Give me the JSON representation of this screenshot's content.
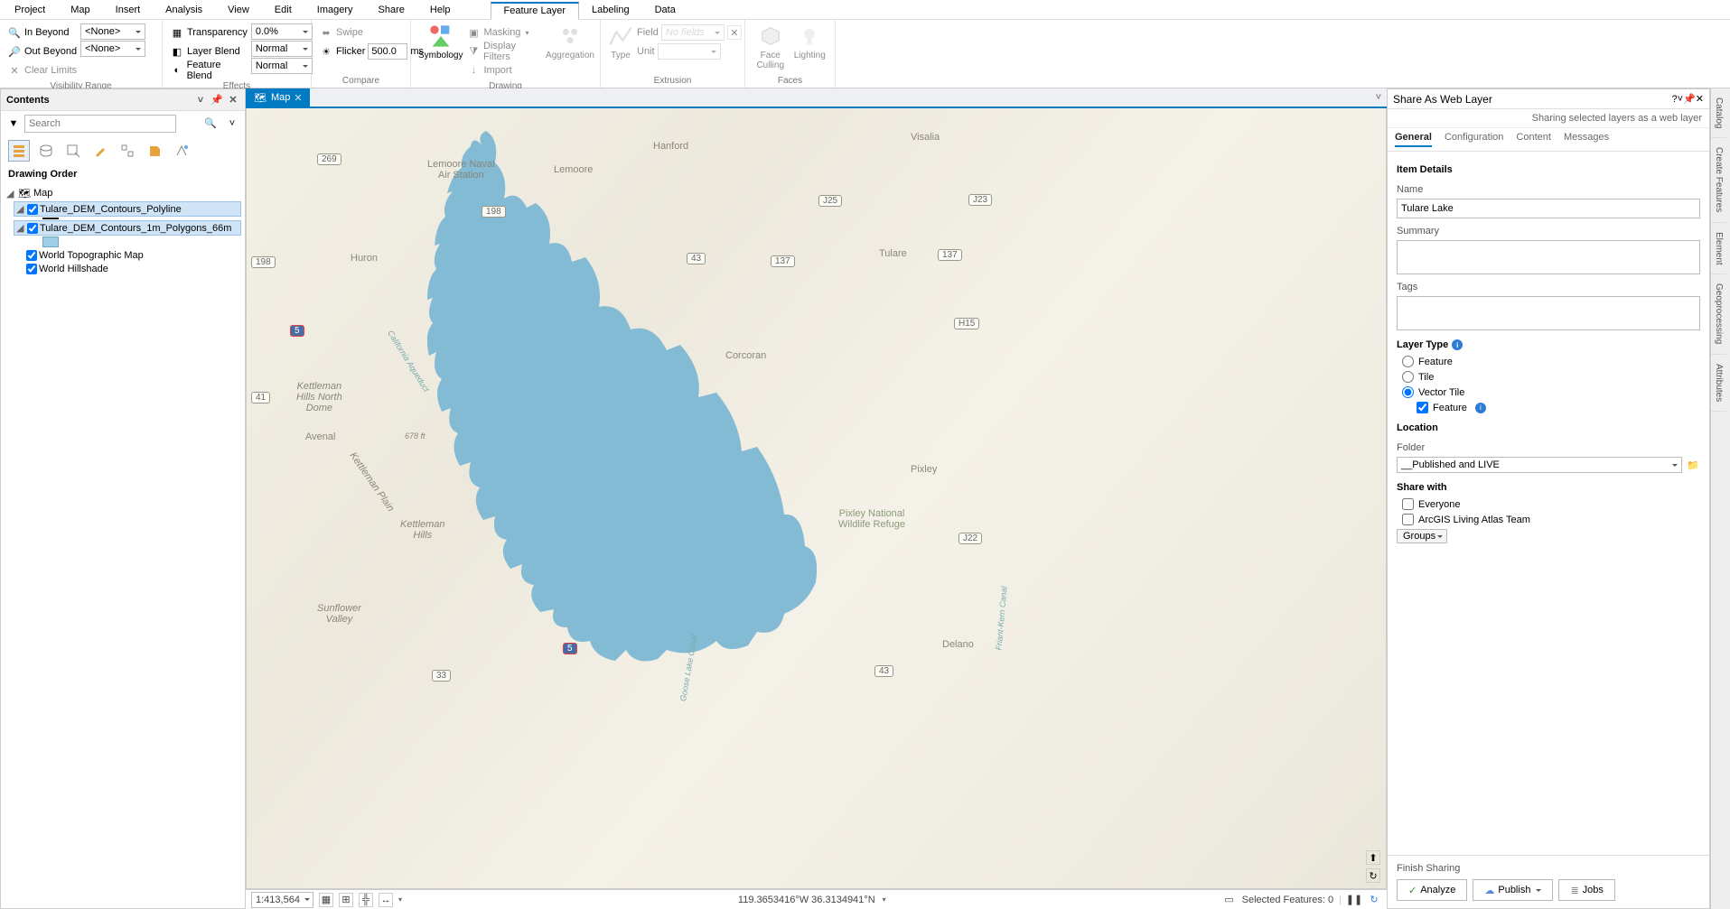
{
  "menu": [
    "Project",
    "Map",
    "Insert",
    "Analysis",
    "View",
    "Edit",
    "Imagery",
    "Share",
    "Help"
  ],
  "context_tabs": [
    "Feature Layer",
    "Labeling",
    "Data"
  ],
  "ribbon": {
    "visibility": {
      "in_beyond": "In Beyond",
      "out_beyond": "Out Beyond",
      "clear": "Clear Limits",
      "none": "<None>",
      "group": "Visibility Range"
    },
    "effects": {
      "transparency": "Transparency",
      "transparency_val": "0.0%",
      "layer_blend": "Layer Blend",
      "feature_blend": "Feature Blend",
      "normal": "Normal",
      "group": "Effects"
    },
    "compare": {
      "swipe": "Swipe",
      "flicker": "Flicker",
      "flicker_val": "500.0",
      "flicker_unit": "ms",
      "group": "Compare"
    },
    "drawing": {
      "symbology": "Symbology",
      "masking": "Masking",
      "display_filters": "Display Filters",
      "import": "Import",
      "aggregation": "Aggregation",
      "group": "Drawing"
    },
    "extrusion": {
      "type": "Type",
      "field": "Field",
      "unit": "Unit",
      "no_fields": "No fields",
      "group": "Extrusion"
    },
    "faces": {
      "face_culling": "Face\nCulling",
      "lighting": "Lighting",
      "group": "Faces"
    }
  },
  "contents": {
    "title": "Contents",
    "search_placeholder": "Search",
    "draw_order": "Drawing Order",
    "map_root": "Map",
    "layers": {
      "poly_line": "Tulare_DEM_Contours_Polyline",
      "polygons": "Tulare_DEM_Contours_1m_Polygons_66m",
      "topo": "World Topographic Map",
      "hillshade": "World Hillshade"
    }
  },
  "map_tab": "Map",
  "map_labels": {
    "lemoore_nas": "Lemoore Naval\nAir Station",
    "lemoore": "Lemoore",
    "hanford": "Hanford",
    "visalia": "Visalia",
    "tulare": "Tulare",
    "huron": "Huron",
    "avenal": "Avenal",
    "corcoran": "Corcoran",
    "pixley": "Pixley",
    "pixley_nwr": "Pixley National\nWildlife Refuge",
    "delano": "Delano",
    "sunflower": "Sunflower\nValley",
    "kettleman": "Kettleman\nHills",
    "kettleman_n": "Kettleman\nHills North\nDome",
    "kettleman_plain": "Kettleman Plain",
    "r269": "269",
    "r198": "198",
    "r41": "41",
    "r43": "43",
    "r137": "137",
    "i5": "5",
    "r33": "33",
    "j22": "J22",
    "j23": "J23",
    "j25": "J25",
    "h15": "H15",
    "ft678": "678 ft",
    "goose_lake": "Goose Lake Canal",
    "friant_kern": "Friant-Kern Canal",
    "cal_aqueduct": "California Aqueduct"
  },
  "status": {
    "scale": "1:413,564",
    "coords": "119.3653416°W 36.3134941°N",
    "selected": "Selected Features: 0"
  },
  "share": {
    "title": "Share As Web Layer",
    "subtitle": "Sharing selected layers as a web layer",
    "tabs": [
      "General",
      "Configuration",
      "Content",
      "Messages"
    ],
    "item_details": "Item Details",
    "name": "Name",
    "name_val": "Tulare Lake",
    "summary": "Summary",
    "tags": "Tags",
    "layer_type": "Layer Type",
    "feature": "Feature",
    "tile": "Tile",
    "vector_tile": "Vector Tile",
    "feature_cb": "Feature",
    "location": "Location",
    "folder": "Folder",
    "folder_val": "__Published and LIVE",
    "share_with": "Share with",
    "everyone": "Everyone",
    "living_atlas": "ArcGIS Living Atlas Team",
    "groups": "Groups",
    "finish": "Finish Sharing",
    "analyze": "Analyze",
    "publish": "Publish",
    "jobs": "Jobs"
  },
  "right_tabs": [
    "Catalog",
    "Create Features",
    "Element",
    "Geoprocessing",
    "Attributes"
  ]
}
